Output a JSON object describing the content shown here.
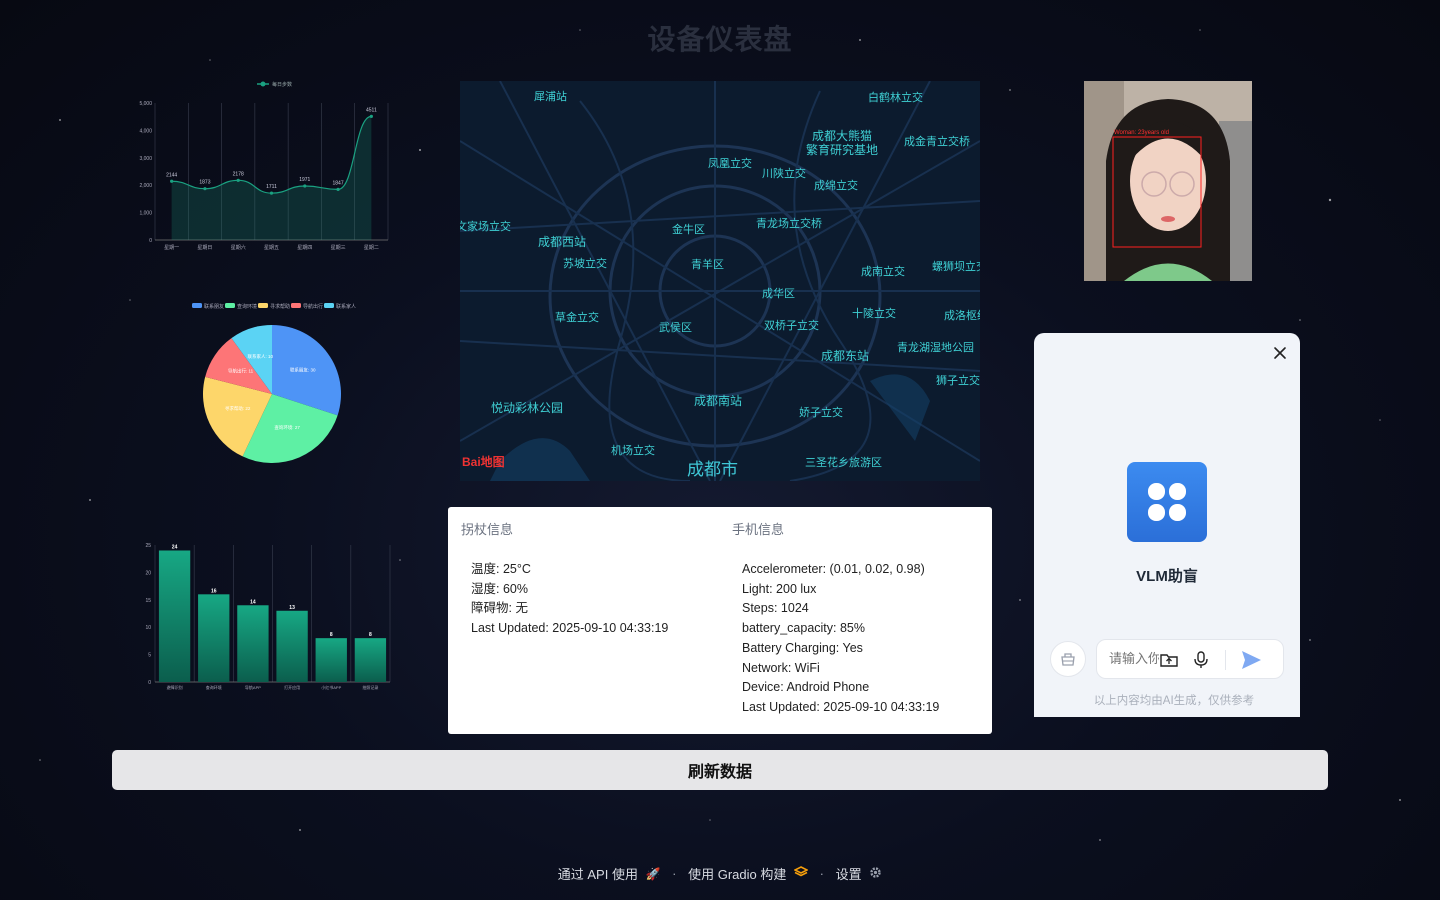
{
  "page": {
    "title": "设备仪表盘"
  },
  "line_chart": {
    "chart_data": {
      "type": "line",
      "legend": [
        "每日步数"
      ],
      "categories": [
        "星期一",
        "星期日",
        "星期六",
        "星期五",
        "星期四",
        "星期三",
        "星期二"
      ],
      "series": [
        {
          "name": "每日步数",
          "values": [
            2144,
            1873,
            2178,
            1711,
            1971,
            1847,
            4511
          ]
        }
      ],
      "ylim": [
        0,
        5000
      ],
      "yticks": [
        "0",
        "1,000",
        "2,000",
        "3,000",
        "4,000",
        "5,000"
      ],
      "color": "#1aa181"
    }
  },
  "pie_chart": {
    "chart_data": {
      "type": "pie",
      "legend": [
        "联系朋友",
        "查询环境",
        "寻求帮助",
        "导航出行",
        "联系家人"
      ],
      "slices": [
        {
          "label": "联系朋友",
          "value": 30,
          "color": "#4e94f6"
        },
        {
          "label": "查询环境",
          "value": 27,
          "color": "#5ef0a4"
        },
        {
          "label": "寻求帮助",
          "value": 22,
          "color": "#fdd66a"
        },
        {
          "label": "导航出行",
          "value": 11,
          "color": "#fd7577"
        },
        {
          "label": "联系家人",
          "value": 10,
          "color": "#5bd3f4"
        }
      ]
    }
  },
  "bar_chart": {
    "chart_data": {
      "type": "bar",
      "categories": [
        "避障识别",
        "查询环境",
        "导航APP",
        "打开应用",
        "小红书APP",
        "拍照记录"
      ],
      "values": [
        24,
        16,
        14,
        13,
        8,
        8
      ],
      "ylim": [
        0,
        25
      ],
      "yticks": [
        "0",
        "5",
        "10",
        "15",
        "20",
        "25"
      ],
      "color": "#139a7c"
    }
  },
  "map": {
    "labels": [
      "犀浦站",
      "白鹤林立交",
      "成都大熊猫",
      "繁育研究基地",
      "成金青立交桥",
      "凤凰立交",
      "川陕立交",
      "成绵立交",
      "文家场立交",
      "金牛区",
      "青龙场立交桥",
      "成都西站",
      "苏坡立交",
      "青羊区",
      "成南立交",
      "螺狮坝立交",
      "成华区",
      "草金立交",
      "十陵立交",
      "武侯区",
      "双桥子立交",
      "成洛枢纽",
      "成都东站",
      "青龙湖湿地公园",
      "狮子立交",
      "悦动彩林公园",
      "成都南站",
      "娇子立交",
      "机场立交",
      "成都市",
      "三圣花乡旅游区"
    ],
    "logo": "Bai地图"
  },
  "cane_info": {
    "header": "拐杖信息",
    "lines": [
      "温度: 25°C",
      "湿度: 60%",
      "障碍物: 无",
      "Last Updated: 2025-09-10 04:33:19"
    ]
  },
  "phone_info": {
    "header": "手机信息",
    "lines": [
      "Accelerometer: (0.01, 0.02, 0.98)",
      "Light: 200 lux",
      "Steps: 1024",
      "battery_capacity: 85%",
      "Battery Charging: Yes",
      "Network: WiFi",
      "Device: Android Phone",
      "Last Updated: 2025-09-10 04:33:19"
    ]
  },
  "photo": {
    "detection_label": "Woman: 23years old"
  },
  "chat": {
    "app_name": "VLM助盲",
    "input_placeholder": "请输入你的问题",
    "disclaimer": "以上内容均由AI生成，仅供参考"
  },
  "refresh_button": {
    "label": "刷新数据"
  },
  "footer": {
    "api": "通过 API 使用",
    "gradio": "使用 Gradio 构建",
    "settings": "设置",
    "separator": "·"
  }
}
